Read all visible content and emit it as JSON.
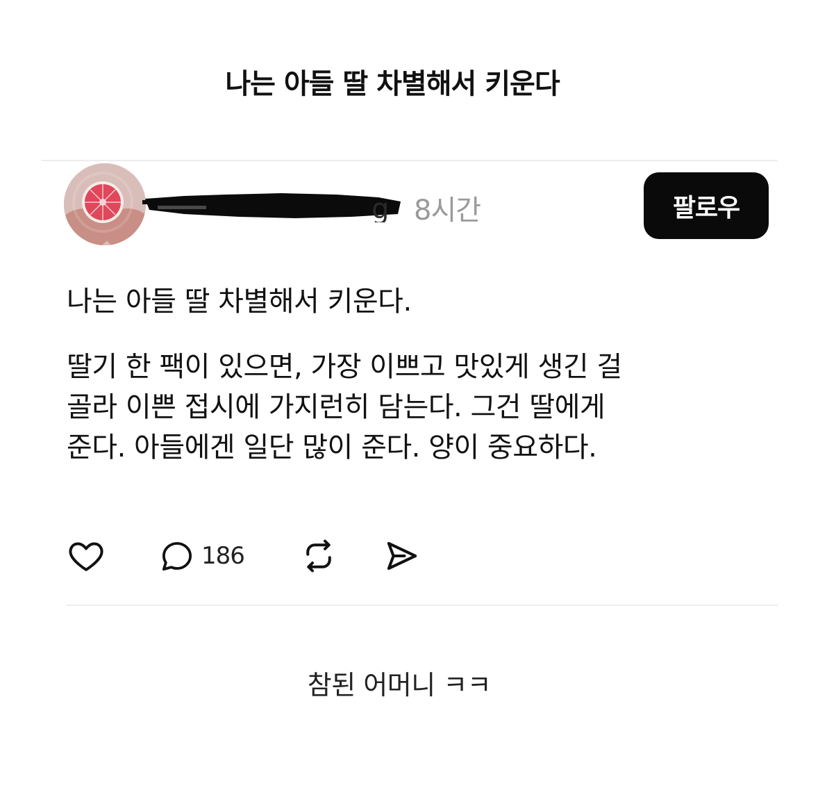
{
  "page_title": "나는 아들 딸 차별해서 키운다",
  "post": {
    "author": {
      "avatar_icon": "grapefruit-avatar-icon",
      "username_visible_fragment": "g"
    },
    "timestamp": "8시간",
    "follow_label": "팔로우",
    "body": {
      "paragraph_1": "나는 아들 딸 차별해서 키운다.",
      "paragraph_2_line_1": "딸기 한 팩이 있으면, 가장 이쁘고 맛있게 생긴 걸",
      "paragraph_2_line_2": "골라 이쁜 접시에 가지런히 담는다. 그건 딸에게",
      "paragraph_2_line_3": "준다. 아들에겐 일단 많이 준다. 양이 중요하다."
    },
    "actions": {
      "like_icon": "heart-icon",
      "comment_icon": "comment-bubble-icon",
      "comment_count": "186",
      "repost_icon": "repost-icon",
      "share_icon": "send-icon"
    }
  },
  "caption": "참된 어머니 ㅋㅋ",
  "colors": {
    "follow_button_bg": "#0a0a0a",
    "timestamp": "#9a9a9a",
    "avatar_fruit": "#e0475a"
  }
}
